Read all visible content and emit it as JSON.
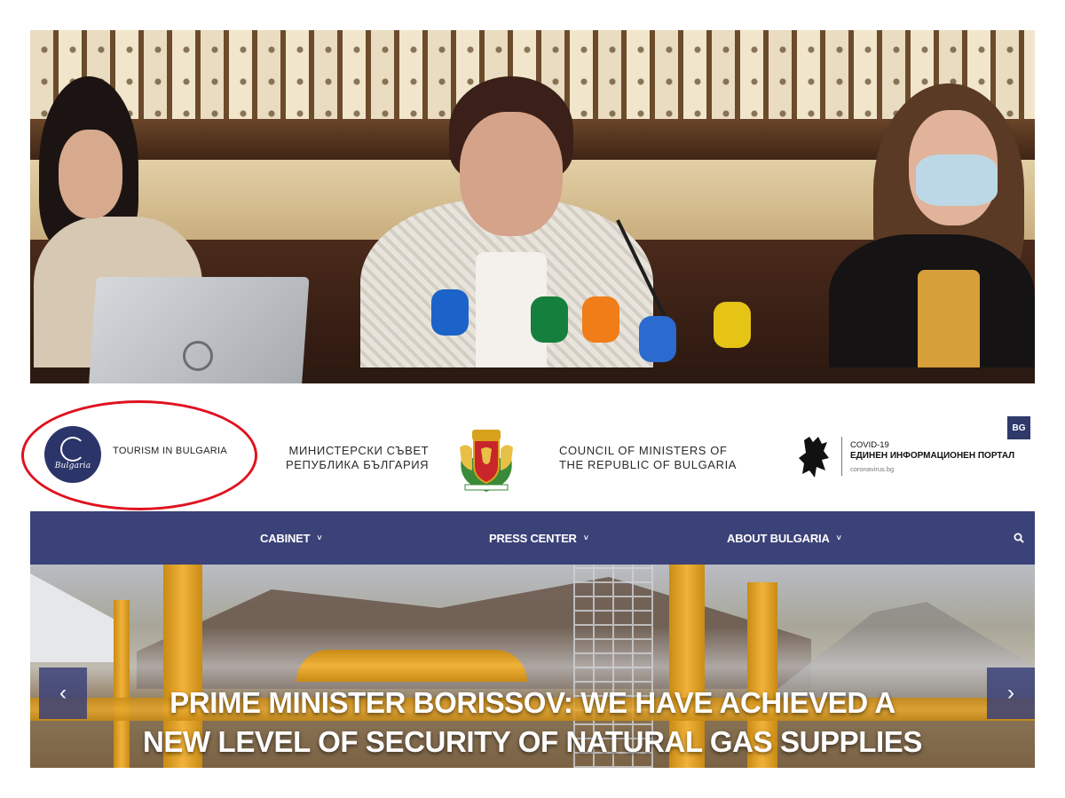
{
  "header": {
    "tourism_label": "TOURISM IN BULGARIA",
    "tourism_logo_word": "Bulgaria",
    "council_bg_line1": "МИНИСТЕРСКИ СЪВЕТ",
    "council_bg_line2": "РЕПУБЛИКА БЪЛГАРИЯ",
    "council_en_line1": "COUNCIL OF MINISTERS OF",
    "council_en_line2": "THE REPUBLIC OF BULGARIA",
    "covid_line1": "COVID-19",
    "covid_line2": "ЕДИНЕН ИНФОРМАЦИОНЕН ПОРТАЛ",
    "covid_url": "coronavirus.bg",
    "language_button": "BG"
  },
  "nav": {
    "items": [
      {
        "label": "CABINET"
      },
      {
        "label": "PRESS CENTER"
      },
      {
        "label": "ABOUT BULGARIA"
      }
    ],
    "chevron": "˅"
  },
  "hero": {
    "title_line1": "PRIME MINISTER BORISSOV: WE HAVE ACHIEVED A",
    "title_line2": "NEW LEVEL OF SECURITY OF NATURAL GAS SUPPLIES",
    "prev_arrow": "‹",
    "next_arrow": "›"
  },
  "colors": {
    "nav_background": "#3b4278",
    "highlight_ring": "#e0121f",
    "tourism_logo": "#2c3569"
  },
  "icons": [
    "search-icon",
    "chevron-down-icon",
    "arrow-left-icon",
    "arrow-right-icon",
    "coat-of-arms-icon",
    "lion-icon"
  ]
}
